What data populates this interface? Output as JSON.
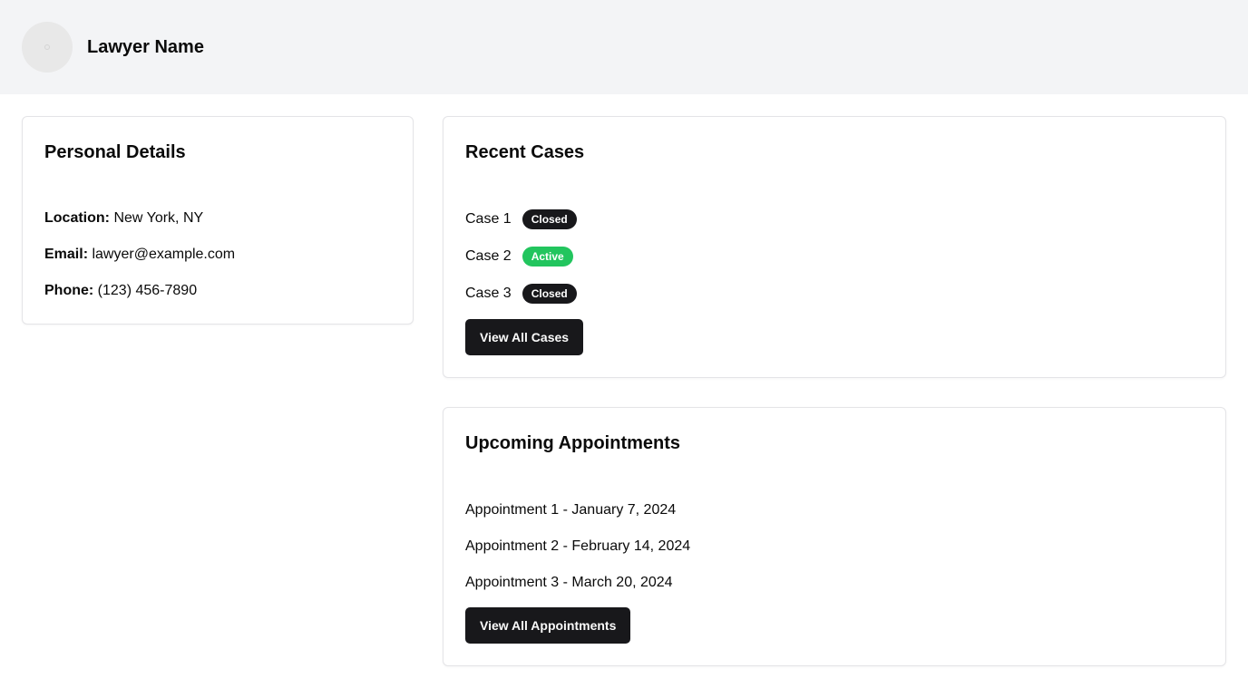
{
  "header": {
    "lawyer_name": "Lawyer Name"
  },
  "personal": {
    "title": "Personal Details",
    "location_label": "Location:",
    "location_value": "New York, NY",
    "email_label": "Email:",
    "email_value": "lawyer@example.com",
    "phone_label": "Phone:",
    "phone_value": "(123) 456-7890"
  },
  "cases": {
    "title": "Recent Cases",
    "items": [
      {
        "name": "Case 1",
        "status": "Closed",
        "status_color": "#18181b"
      },
      {
        "name": "Case 2",
        "status": "Active",
        "status_color": "#22c55e"
      },
      {
        "name": "Case 3",
        "status": "Closed",
        "status_color": "#18181b"
      }
    ],
    "button_label": "View All Cases"
  },
  "appointments": {
    "title": "Upcoming Appointments",
    "items": [
      "Appointment 1 - January 7, 2024",
      "Appointment 2 - February 14, 2024",
      "Appointment 3 - March 20, 2024"
    ],
    "button_label": "View All Appointments"
  }
}
